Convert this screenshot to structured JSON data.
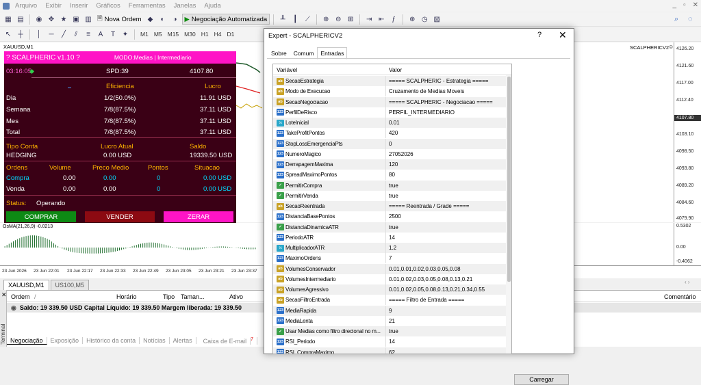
{
  "menu": [
    "Arquivo",
    "Exibir",
    "Inserir",
    "Gráficos",
    "Ferramentas",
    "Janelas",
    "Ajuda"
  ],
  "toolbar": {
    "nova_ordem": "Nova Ordem",
    "algo": "Negociação Automatizada",
    "timeframes": [
      "M1",
      "M5",
      "M15",
      "M30",
      "H1",
      "H4",
      "D1"
    ]
  },
  "chart": {
    "symbol_label": "XAUUSD,M1",
    "ea_label": "SCALPHERICV2",
    "price_ticks": [
      "4126.20",
      "4121.60",
      "4117.00",
      "4112.40",
      "4107.80",
      "4103.10",
      "4098.50",
      "4093.80",
      "4089.20",
      "4084.60",
      "4079.90"
    ],
    "current_price": "4107.80",
    "osc_label": "OsMA(21,26,9) -0.0213",
    "osc_ticks": [
      "0.5302",
      "0.00",
      "-0.4062"
    ],
    "time_ticks": [
      "23 Jun 2026",
      "23 Jun 22:01",
      "23 Jun 22:17",
      "23 Jun 22:33",
      "23 Jun 22:49",
      "23 Jun 23:05",
      "23 Jun 23:21",
      "23 Jun 23:37"
    ]
  },
  "panel": {
    "title": "? SCALPHERIC v1.10 ?",
    "mode": "MODO:Medias | Intermediario",
    "time": "03:16:05",
    "spd": "SPD:39",
    "price": "4107.80",
    "h_efic": "Eficiencia",
    "h_lucro": "Lucro",
    "stats": [
      {
        "label": "Dia",
        "eff": "1/2(50.0%)",
        "profit": "11.91 USD"
      },
      {
        "label": "Semana",
        "eff": "7/8(87.5%)",
        "profit": "37.11 USD"
      },
      {
        "label": "Mes",
        "eff": "7/8(87.5%)",
        "profit": "37.11 USD"
      },
      {
        "label": "Total",
        "eff": "7/8(87.5%)",
        "profit": "37.11 USD"
      }
    ],
    "h_tipo": "Tipo Conta",
    "h_lucro_atual": "Lucro Atual",
    "h_saldo": "Saldo",
    "tipo": "HEDGING",
    "lucro_atual": "0.00 USD",
    "saldo": "19339.50 USD",
    "orders_head": [
      "Ordens",
      "Volume",
      "Preco Medio",
      "Pontos",
      "Situacao"
    ],
    "orders": [
      {
        "label": "Compra",
        "vol": "0.00",
        "pm": "0.00",
        "pts": "0",
        "sit": "0.00 USD"
      },
      {
        "label": "Venda",
        "vol": "0.00",
        "pm": "0.00",
        "pts": "0",
        "sit": "0.00 USD"
      }
    ],
    "status_label": "Status:",
    "status_value": "Operando",
    "btn_buy": "COMPRAR",
    "btn_sell": "VENDER",
    "btn_zero": "ZERAR"
  },
  "chart_tabs": [
    "XAUUSD,M1",
    "US100,M5"
  ],
  "terminal": {
    "cols": [
      "Ordem",
      "/",
      "Horário",
      "Tipo",
      "Taman...",
      "Ativo",
      "Comentário"
    ],
    "saldo_line": "Saldo: 19 339.50 USD  Capital Líquido: 19 339.50  Margem liberada: 19 339.50",
    "tabs": [
      "Negociação",
      "Exposição",
      "Histórico da conta",
      "Notícias",
      "Alertas",
      "Caixa de E-mail"
    ],
    "side_label": "Terminal",
    "mail_badge": "7"
  },
  "dialog": {
    "title": "Expert - SCALPHERICV2",
    "help": "?",
    "close": "✕",
    "tabs": [
      "Sobre",
      "Comum",
      "Entradas"
    ],
    "col_var": "Variável",
    "col_val": "Valor",
    "load_button": "Carregar",
    "rows": [
      {
        "t": "ab",
        "n": "SecaoEstrategia",
        "v": "===== SCALPHERIC - Estrategia ====="
      },
      {
        "t": "ab",
        "n": "Modo de Execucao",
        "v": "Cruzamento de Medias Moveis"
      },
      {
        "t": "ab",
        "n": "SecaoNegociacao",
        "v": "===== SCALPHERIC - Negociacao ====="
      },
      {
        "t": "123",
        "n": "PerfilDeRisco",
        "v": "PERFIL_INTERMEDIARIO"
      },
      {
        "t": "v2",
        "n": "LoteInicial",
        "v": "0.01"
      },
      {
        "t": "123",
        "n": "TakeProfitPontos",
        "v": "420"
      },
      {
        "t": "123",
        "n": "StopLossEmergenciaPts",
        "v": "0"
      },
      {
        "t": "123",
        "n": "NumeroMagico",
        "v": "27052026"
      },
      {
        "t": "123",
        "n": "DerrapagemMaxima",
        "v": "120"
      },
      {
        "t": "123",
        "n": "SpreadMaximoPontos",
        "v": "80"
      },
      {
        "t": "bool",
        "n": "PermitirCompra",
        "v": "true"
      },
      {
        "t": "bool",
        "n": "PermitirVenda",
        "v": "true"
      },
      {
        "t": "ab",
        "n": "SecaoReentrada",
        "v": "===== Reentrada / Grade ====="
      },
      {
        "t": "123",
        "n": "DistanciaBasePontos",
        "v": "2500"
      },
      {
        "t": "bool",
        "n": "DistanciaDinamicaATR",
        "v": "true"
      },
      {
        "t": "123",
        "n": "PeriodoATR",
        "v": "14"
      },
      {
        "t": "v2",
        "n": "MultiplicadorATR",
        "v": "1.2"
      },
      {
        "t": "123",
        "n": "MaximoOrdens",
        "v": "7"
      },
      {
        "t": "ab",
        "n": "VolumesConservador",
        "v": "0.01,0.01,0.02,0.03,0.05,0.08"
      },
      {
        "t": "ab",
        "n": "VolumesIntermediario",
        "v": "0.01,0.02,0.03,0.05,0.08,0.13,0.21"
      },
      {
        "t": "ab",
        "n": "VolumesAgressivo",
        "v": "0.01,0.02,0.05,0.08,0.13,0.21,0.34,0.55"
      },
      {
        "t": "ab",
        "n": "SecaoFiltroEntrada",
        "v": "===== Filtro de Entrada ====="
      },
      {
        "t": "123",
        "n": "MediaRapida",
        "v": "9"
      },
      {
        "t": "123",
        "n": "MediaLenta",
        "v": "21"
      },
      {
        "t": "bool",
        "n": "Usar Medias como filtro direcional no m...",
        "v": "true"
      },
      {
        "t": "123",
        "n": "RSI_Periodo",
        "v": "14"
      },
      {
        "t": "123",
        "n": "RSI_CompraMaximo",
        "v": "62"
      }
    ]
  },
  "colors": {
    "panel_bg": "#3a0015",
    "panel_head": "#ff14c6",
    "buy": "#0d8a14",
    "sell": "#8c0a12",
    "zero": "#ff14c6"
  }
}
